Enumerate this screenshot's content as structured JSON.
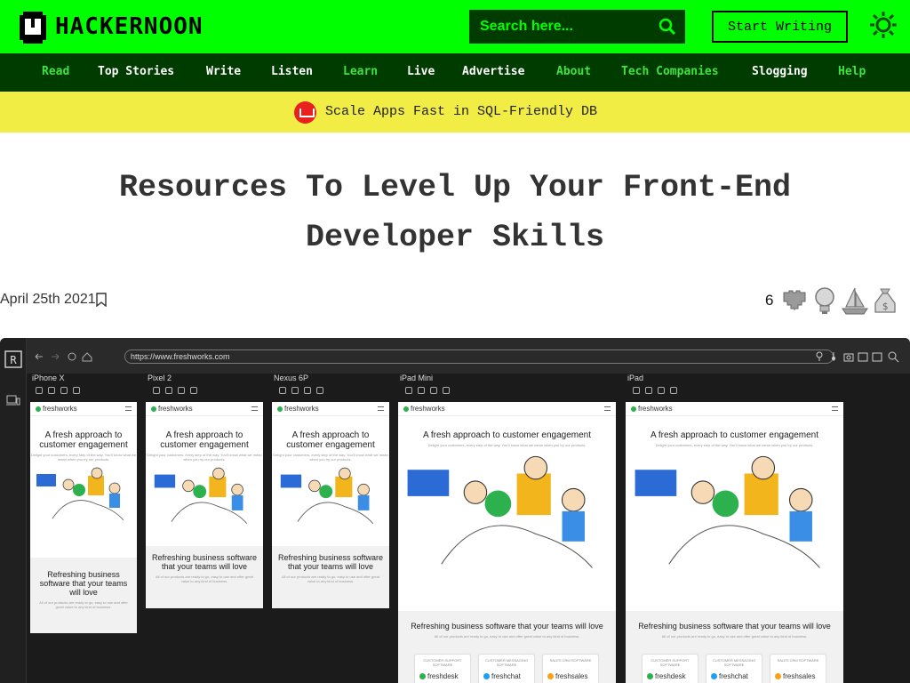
{
  "header": {
    "logo_text": "HACKERNOON",
    "search_placeholder": "Search here...",
    "start_writing": "Start Writing"
  },
  "nav": [
    {
      "label": "Read",
      "highlight": true
    },
    {
      "label": "Top Stories",
      "highlight": false
    },
    {
      "label": "Write",
      "highlight": false
    },
    {
      "label": "Listen",
      "highlight": false
    },
    {
      "label": "Learn",
      "highlight": true
    },
    {
      "label": "Live",
      "highlight": false
    },
    {
      "label": "Advertise",
      "highlight": false
    },
    {
      "label": "About",
      "highlight": true
    },
    {
      "label": "Tech Companies",
      "highlight": true
    },
    {
      "label": "Slogging",
      "highlight": false
    },
    {
      "label": "Help",
      "highlight": true
    }
  ],
  "promo": {
    "text": "Scale Apps Fast in SQL-Friendly DB"
  },
  "article": {
    "title": "Resources To Level Up Your Front-End Developer Skills",
    "date": "April 25th 2021",
    "reaction_count": "6",
    "reaction_icons": [
      "heart-icon",
      "lightbulb-icon",
      "boat-icon",
      "money-bag-icon"
    ]
  },
  "hero": {
    "url": "https://www.freshworks.com",
    "devices": [
      {
        "name": "iPhone X",
        "headline": "A fresh approach to customer engagement",
        "section": "Refreshing business software that your teams will love"
      },
      {
        "name": "Pixel 2",
        "headline": "A fresh approach to customer engagement",
        "section": "Refreshing business software that your teams will love"
      },
      {
        "name": "Nexus 6P",
        "headline": "A fresh approach to customer engagement",
        "section": "Refreshing business software that your teams will love"
      },
      {
        "name": "iPad Mini",
        "headline": "A fresh approach to customer engagement",
        "section": "Refreshing business software that your teams will love"
      },
      {
        "name": "iPad",
        "headline": "A fresh approach to customer engagement",
        "section": "Refreshing business software that your teams will love"
      }
    ],
    "fw_logo": "freshworks",
    "sub_text": "Delight your customers, every step of the way. You'll know what we mean when you try our products.",
    "note_text": "All of our products are ready to go, easy to use and offer great value to any kind of business.",
    "cards": [
      {
        "label": "CUSTOMER SUPPORT SOFTWARE",
        "brand": "freshdesk",
        "color": "#2db14f"
      },
      {
        "label": "CUSTOMER MESSAGING SOFTWARE",
        "brand": "freshchat",
        "color": "#1ea0f0"
      },
      {
        "label": "SALES CRM SOFTWARE",
        "brand": "freshsales",
        "color": "#f8a21a"
      }
    ]
  }
}
